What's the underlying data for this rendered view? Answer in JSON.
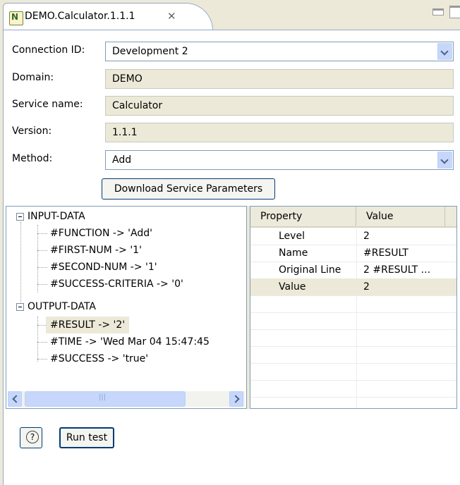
{
  "tab": {
    "title": "DEMO.Calculator.1.1.1",
    "close_glyph": "✕",
    "icon": "notes-agent-icon"
  },
  "form": {
    "connection": {
      "label": "Connection ID:",
      "value": "Development 2"
    },
    "domain": {
      "label": "Domain:",
      "value": "DEMO"
    },
    "service": {
      "label": "Service name:",
      "value": "Calculator"
    },
    "version": {
      "label": "Version:",
      "value": "1.1.1"
    },
    "method": {
      "label": "Method:",
      "value": "Add"
    },
    "download_label": "Download Service Parameters"
  },
  "tree": {
    "input_group": "INPUT-DATA",
    "input_items": [
      "#FUNCTION -> 'Add'",
      "#FIRST-NUM -> '1'",
      "#SECOND-NUM -> '1'",
      "#SUCCESS-CRITERIA -> '0'"
    ],
    "output_group": "OUTPUT-DATA",
    "output_items": [
      "#RESULT -> '2'",
      "#TIME -> 'Wed Mar 04 15:47:45",
      "#SUCCESS -> 'true'"
    ],
    "scroll_thumb_glyph": "|||"
  },
  "properties": {
    "headers": [
      "Property",
      "Value"
    ],
    "rows": [
      {
        "property": "Level",
        "value": "2"
      },
      {
        "property": "Name",
        "value": "#RESULT"
      },
      {
        "property": "Original Line",
        "value": "2 #RESULT ..."
      },
      {
        "property": "Value",
        "value": "2"
      }
    ],
    "selected_row": 3
  },
  "buttons": {
    "help_glyph": "?",
    "run_label": "Run test"
  },
  "colors": {
    "window_bg": "#ece9d8",
    "selection": "#ece9d8",
    "border": "#7f9db9",
    "combo_button": "#c6d7fb"
  }
}
